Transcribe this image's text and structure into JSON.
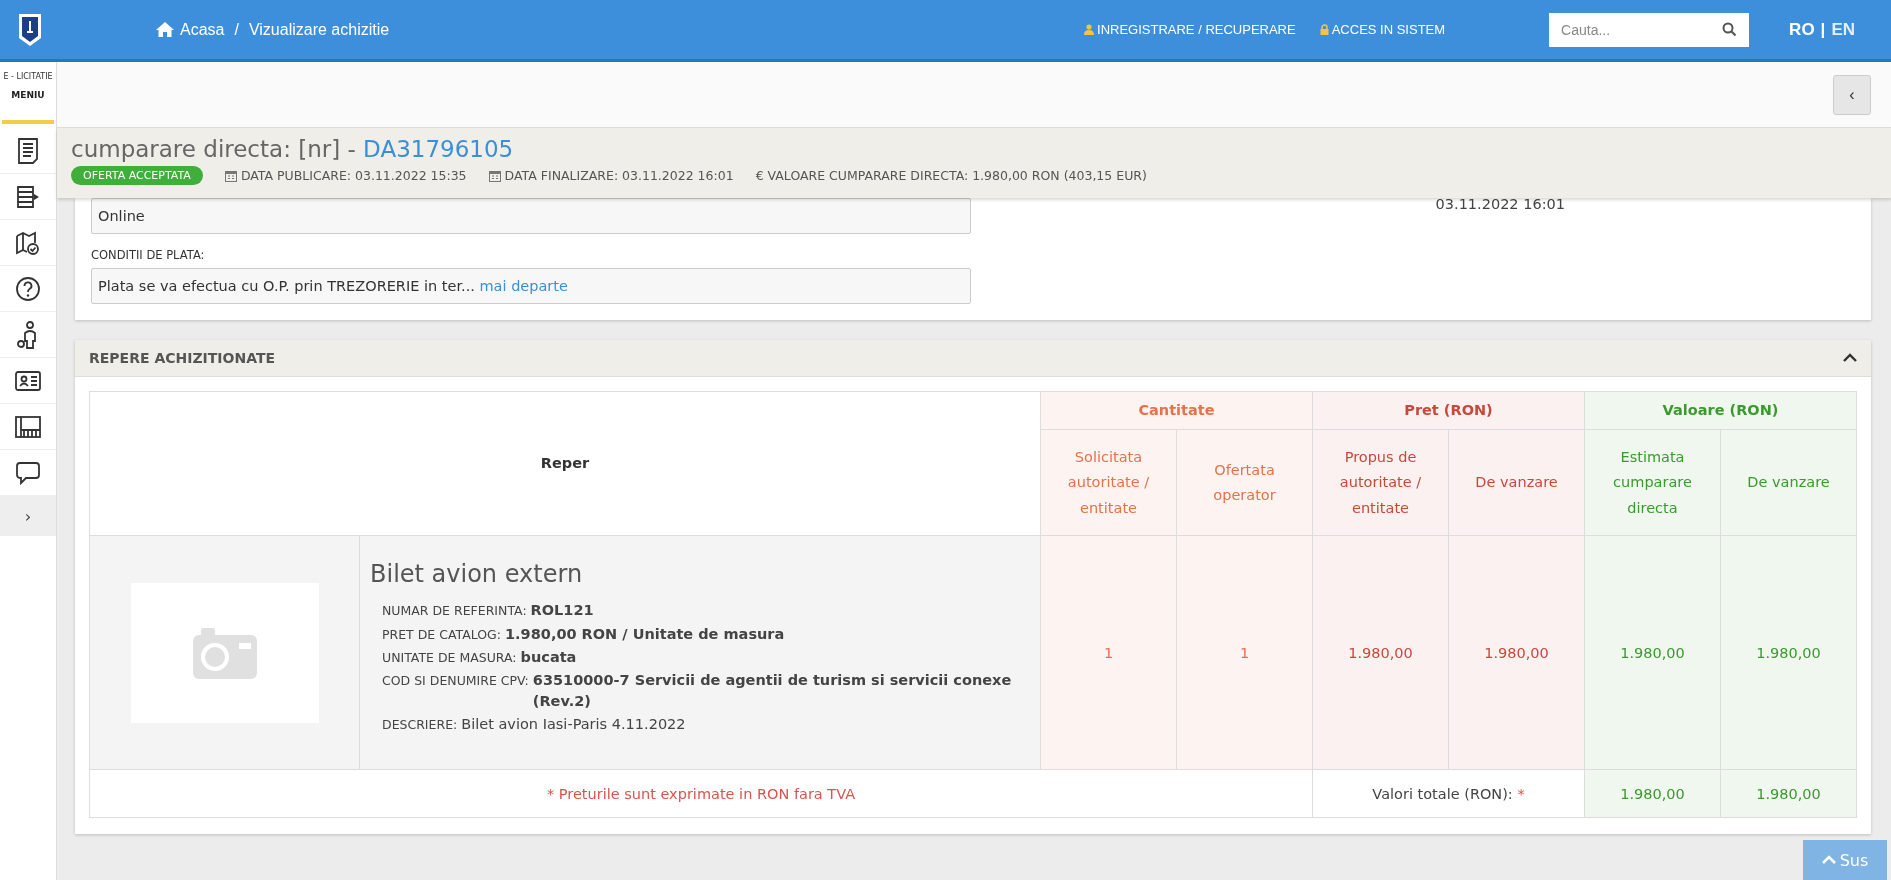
{
  "topbar": {
    "home": "Acasa",
    "separator": "/",
    "page": "Vizualizare achizitie",
    "links": [
      "INREGISTRARE / RECUPERARE",
      "ACCES IN SISTEM"
    ],
    "search": {
      "placeholder": "Cauta..."
    },
    "languages": [
      {
        "label": "RO",
        "selected": true
      },
      {
        "label": "EN",
        "selected": false
      }
    ],
    "lang_separator": "|"
  },
  "sidebar": {
    "brand": "E - LICITATIE",
    "title": "MENIU",
    "items": [
      {
        "kind": "document"
      },
      {
        "kind": "list-arrow"
      },
      {
        "kind": "map-check"
      },
      {
        "kind": "help"
      },
      {
        "kind": "person"
      },
      {
        "kind": "id-card"
      },
      {
        "kind": "catalog"
      },
      {
        "kind": "chat"
      }
    ],
    "expand": "›"
  },
  "subbar": {
    "collapse": "‹"
  },
  "header": {
    "title": "cumparare directa: [nr] - ",
    "code": "DA31796105",
    "status": "OFERTA ACCEPTATA",
    "meta": [
      {
        "kind": "calendar",
        "text": "DATA PUBLICARE: 03.11.2022 15:35"
      },
      {
        "kind": "calendar",
        "text": "DATA FINALIZARE: 03.11.2022 16:01"
      },
      {
        "kind": "plain",
        "text": "€ VALOARE CUMPARARE DIRECTA: 1.980,00  RON (403,15  EUR)"
      }
    ]
  },
  "details": {
    "fields": [
      {
        "value": "Online"
      },
      {
        "label": "CONDITII DE PLATA:",
        "value": "Plata se va efectua cu O.P. prin TREZORERIE in ter...",
        "link": "mai departe"
      }
    ],
    "side_value": "03.11.2022 16:01"
  },
  "items_section": {
    "title": "REPERE ACHIZITIONATE",
    "expanded": true,
    "table": {
      "reper": "Reper",
      "groups": [
        {
          "label": "Cantitate",
          "color": "#e8704a",
          "columns": [
            "Solicitata autoritate / entitate",
            "Ofertata operator"
          ]
        },
        {
          "label": "Pret (RON)",
          "color": "#c9483c",
          "columns": [
            "Propus de autoritate / entitate",
            "De vanzare"
          ]
        },
        {
          "label": "Valoare (RON)",
          "color": "#3a9a2e",
          "columns": [
            "Estimata cumparare directa",
            "De vanzare"
          ]
        }
      ],
      "row": {
        "title": "Bilet avion extern",
        "details": [
          {
            "label": "NUMAR DE REFERINTA:",
            "value": "ROL121",
            "bold": true
          },
          {
            "label": "PRET DE CATALOG:",
            "value": "1.980,00  RON / Unitate de masura",
            "bold": true
          },
          {
            "label": "UNITATE DE MASURA:",
            "value": "bucata",
            "bold": true
          },
          {
            "label": "COD SI DENUMIRE CPV:",
            "value": "63510000-7 Servicii de agentii de turism si servicii conexe (Rev.2)",
            "bold": true
          },
          {
            "label": "DESCRIERE:",
            "value": "Bilet avion Iasi-Paris 4.11.2022",
            "bold": false
          }
        ],
        "values": [
          "1",
          "1",
          "1.980,00",
          "1.980,00",
          "1.980,00",
          "1.980,00"
        ]
      },
      "footer": {
        "note": "* Preturile sunt exprimate in RON fara TVA",
        "totals_label": "Valori totale (RON):",
        "totals_mark": "*",
        "totals": [
          "1.980,00",
          "1.980,00"
        ]
      }
    }
  },
  "back_to_top": "Sus"
}
